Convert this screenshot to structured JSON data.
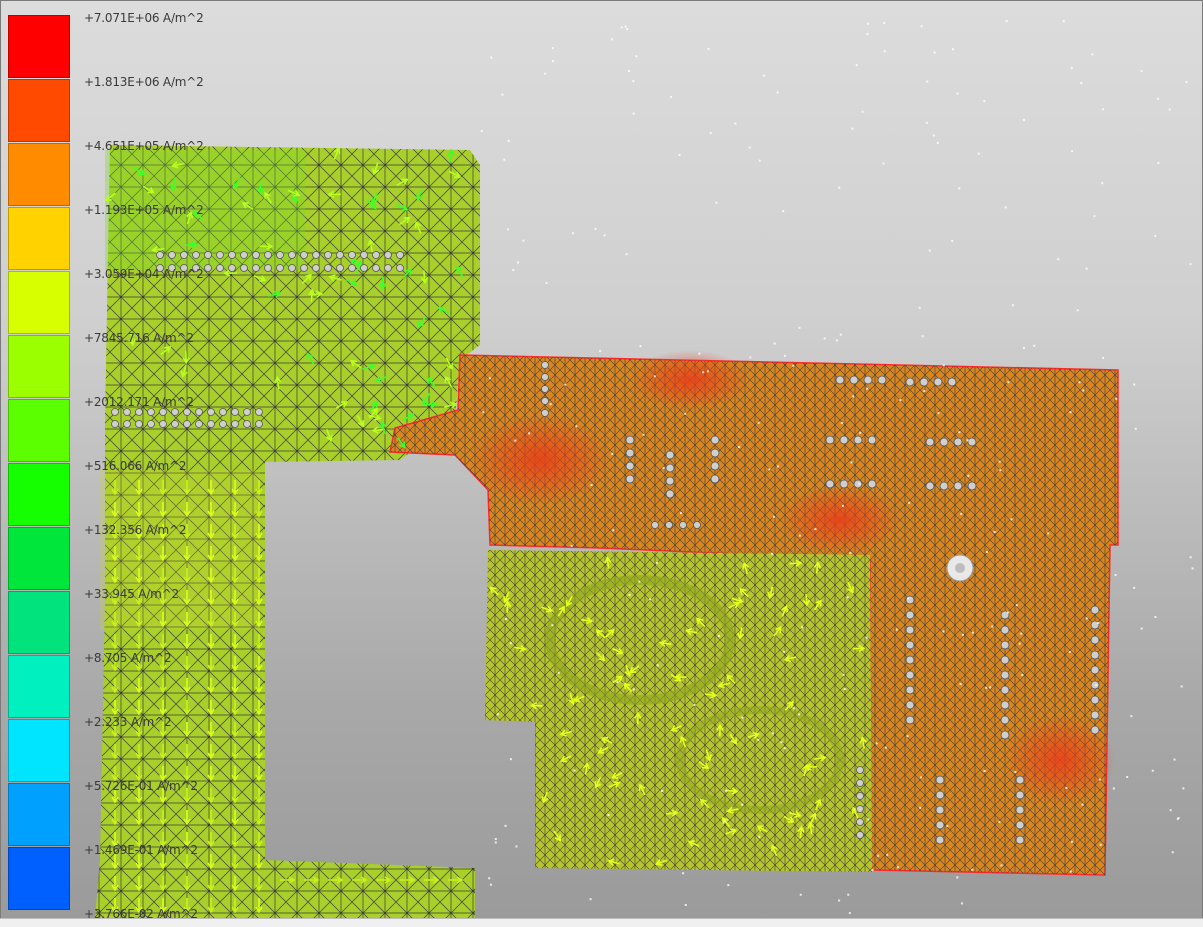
{
  "legend": {
    "colors": [
      "#ff0000",
      "#ff4a00",
      "#ff8c00",
      "#ffd200",
      "#d8ff00",
      "#9cff00",
      "#5cff00",
      "#16ff00",
      "#00e63a",
      "#00e37d",
      "#00f0c0",
      "#00e5ff",
      "#00a0ff",
      "#0060ff"
    ],
    "labels": [
      "+7.071E+06 A/m^2",
      "+1.813E+06 A/m^2",
      "+4.651E+05 A/m^2",
      "+1.193E+05 A/m^2",
      "+3.059E+04 A/m^2",
      "+7845.716 A/m^2",
      "+2012.171 A/m^2",
      "+516.066 A/m^2",
      "+132.356 A/m^2",
      "+33.945 A/m^2",
      "+8.705 A/m^2",
      "+2.233 A/m^2",
      "+5.726E-01 A/m^2",
      "+1.469E-01 A/m^2",
      "+3.766E-02 A/m^2"
    ]
  },
  "colors": {
    "mesh_line": "#3d3d3d",
    "region_high": "#e07a1a",
    "region_mid": "#b9c634",
    "region_low": "#a8d82a",
    "via": "#cfcfcf",
    "board_edge": "#ff2a2a"
  },
  "icons": [
    "current-density-arrows",
    "via-holes",
    "mounting-hole"
  ]
}
